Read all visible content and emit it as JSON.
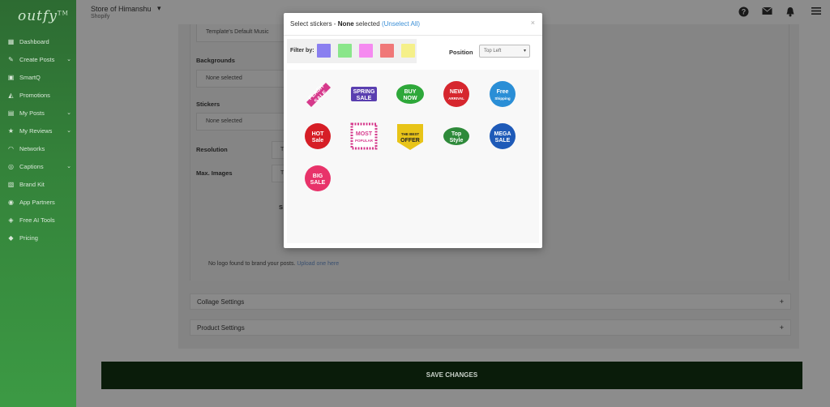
{
  "sidebar": {
    "logo": "outfy",
    "logo_tm": "TM",
    "items": [
      {
        "label": "Dashboard",
        "icon": "dashboard-icon",
        "glyph": "▦",
        "chevron": false
      },
      {
        "label": "Create Posts",
        "icon": "pencil-icon",
        "glyph": "✎",
        "chevron": true
      },
      {
        "label": "SmartQ",
        "icon": "smartq-icon",
        "glyph": "▣",
        "chevron": false
      },
      {
        "label": "Promotions",
        "icon": "megaphone-icon",
        "glyph": "◭",
        "chevron": false
      },
      {
        "label": "My Posts",
        "icon": "folder-icon",
        "glyph": "▤",
        "chevron": true
      },
      {
        "label": "My Reviews",
        "icon": "star-icon",
        "glyph": "★",
        "chevron": true
      },
      {
        "label": "Networks",
        "icon": "wifi-icon",
        "glyph": "◠",
        "chevron": false
      },
      {
        "label": "Captions",
        "icon": "caption-icon",
        "glyph": "◎",
        "chevron": true
      },
      {
        "label": "Brand Kit",
        "icon": "brand-kit-icon",
        "glyph": "▧",
        "chevron": false
      },
      {
        "label": "App Partners",
        "icon": "users-icon",
        "glyph": "◉",
        "chevron": false
      },
      {
        "label": "Free AI Tools",
        "icon": "ai-icon",
        "glyph": "◈",
        "chevron": false
      },
      {
        "label": "Pricing",
        "icon": "tag-icon",
        "glyph": "◆",
        "chevron": false
      }
    ]
  },
  "header": {
    "store_name": "Store of Himanshu",
    "store_platform": "Shopify"
  },
  "form": {
    "music_value": "Template's Default Music",
    "backgrounds_label": "Backgrounds",
    "backgrounds_value": "None selected",
    "stickers_label": "Stickers",
    "stickers_value": "None selected",
    "resolution_label": "Resolution",
    "resolution_value": "T",
    "max_images_label": "Max. Images",
    "max_images_value": "T",
    "partial_text": "S",
    "logo_message": "No logo found to brand your posts.",
    "logo_link": "Upload one here"
  },
  "accordions": {
    "collage": "Collage Settings",
    "product": "Product Settings",
    "expand_glyph": "+"
  },
  "save_button": "SAVE CHANGES",
  "modal": {
    "title_prefix": "Select stickers - ",
    "title_state": "None",
    "title_suffix": " selected",
    "unselect_all": "(Unselect All)",
    "close_glyph": "×",
    "filter_label": "Filter by:",
    "filter_colors": [
      "#8a7ff0",
      "#8ae68a",
      "#f58af0",
      "#f07878",
      "#f5f08a"
    ],
    "position_label": "Position",
    "position_value": "Top Left",
    "stickers": [
      {
        "name": "flash-sale-sticker",
        "line1": "FLASH",
        "line2": "SALE",
        "color": "#d63a8c"
      },
      {
        "name": "spring-sale-sticker",
        "line1": "SPRING",
        "line2": "SALE",
        "color": "#5a3fb0"
      },
      {
        "name": "buy-now-sticker",
        "line1": "BUY",
        "line2": "NOW",
        "color": "#2ea83a"
      },
      {
        "name": "new-arrival-sticker",
        "line1": "NEW",
        "line2": "ARRIVAL",
        "color": "#d6262e"
      },
      {
        "name": "free-shipping-sticker",
        "line1": "Free",
        "line2": "Shipping",
        "color": "#2a8ed6"
      },
      {
        "name": "hot-sale-sticker",
        "line1": "HOT",
        "line2": "Sale",
        "color": "#d61e26"
      },
      {
        "name": "most-popular-sticker",
        "line1": "MOST",
        "line2": "POPULAR",
        "color": "#d63a8c"
      },
      {
        "name": "the-best-offer-sticker",
        "line1": "THE BEST",
        "line2": "OFFER",
        "color": "#e8c418"
      },
      {
        "name": "top-style-sticker",
        "line1": "Top",
        "line2": "Style",
        "color": "#2e8a3a"
      },
      {
        "name": "mega-sale-sticker",
        "line1": "MEGA",
        "line2": "SALE",
        "color": "#1e5ab8"
      },
      {
        "name": "big-sale-sticker",
        "line1": "BIG",
        "line2": "SALE",
        "color": "#e8336a"
      }
    ]
  },
  "top_icons": [
    "help-icon",
    "mail-icon",
    "bell-icon",
    "menu-icon"
  ]
}
